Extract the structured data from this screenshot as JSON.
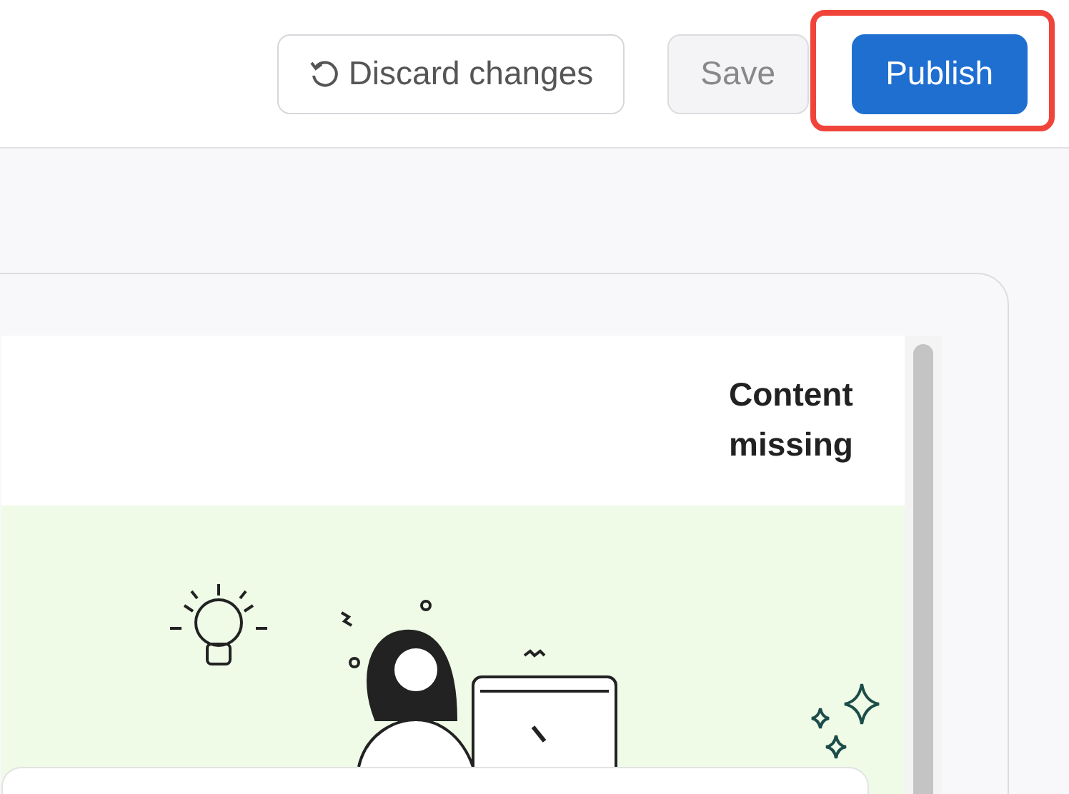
{
  "toolbar": {
    "discard_button": {
      "label": "Discard changes"
    },
    "save_button": {
      "label": "Save"
    },
    "publish_button": {
      "label": "Publish",
      "highlighted": true
    }
  },
  "card": {
    "status": "Content missing"
  }
}
